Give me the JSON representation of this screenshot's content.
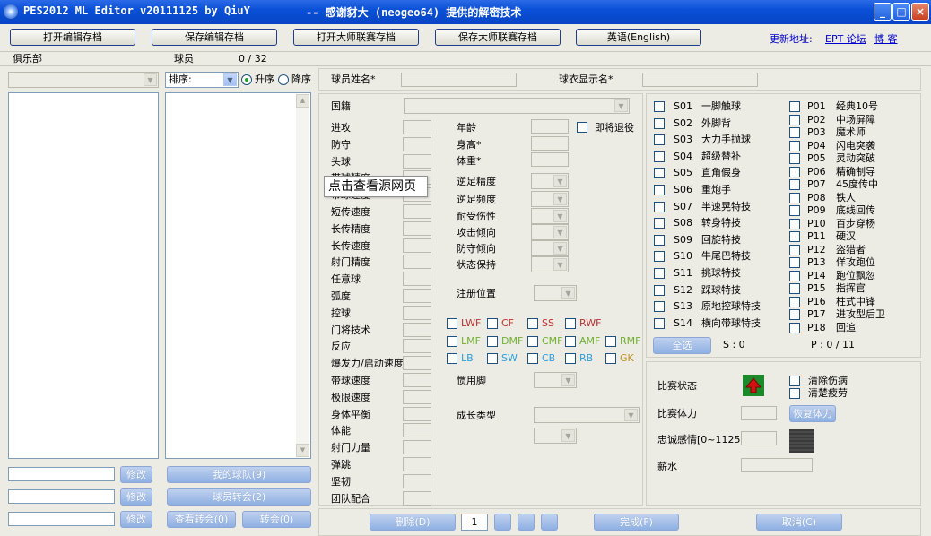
{
  "window": {
    "title": "PES2012 ML Editor v20111125 by QiuY",
    "subtitle": "-- 感谢豺大 (neogeo64) 提供的解密技术",
    "controls": [
      "_",
      "□",
      "×"
    ]
  },
  "toolbar": {
    "open_edit": "打开编辑存档",
    "save_edit": "保存编辑存档",
    "open_ml": "打开大师联赛存档",
    "save_ml": "保存大师联赛存档",
    "language": "英语(English)",
    "update_label": "更新地址:",
    "link_forum": "EPT 论坛",
    "link_blog": "博 客"
  },
  "header": {
    "club_label": "俱乐部",
    "players_label": "球员",
    "players_count": "0 / 32"
  },
  "sort": {
    "value": "排序:",
    "asc": "升序",
    "desc": "降序"
  },
  "left_bottom": {
    "btn_modify1": "修改",
    "btn_modify2": "修改",
    "btn_modify3": "修改",
    "btn_my_players": "我的球队(9)",
    "btn_players_cash": "球员转会(2)",
    "btn_view_transfer": "查看转会(0)",
    "btn_cancel_transfer": "转会(0)"
  },
  "player": {
    "name_label": "球员姓名*",
    "shirt_label": "球衣显示名*",
    "nationality_label": "国籍"
  },
  "attributes": [
    "进攻",
    "防守",
    "头球",
    "带球精度",
    "带球速度",
    "短传速度",
    "长传精度",
    "长传速度",
    "射门精度",
    "任意球",
    "弧度",
    "控球",
    "门将技术",
    "反应",
    "爆发力/启动速度",
    "带球速度",
    "极限速度",
    "身体平衡",
    "体能",
    "射门力量",
    "弹跳",
    "坚韧",
    "团队配合"
  ],
  "bio": {
    "age": "年龄",
    "retire": "即将退役",
    "height": "身高*",
    "weight": "体重*",
    "weak_foot_acc": "逆足精度",
    "weak_foot_freq": "逆足频度",
    "injury_tol": "耐受伤性",
    "attack_tend": "攻击倾向",
    "defend_tend": "防守倾向",
    "form": "状态保持",
    "reg_pos": "注册位置",
    "foot": "惯用脚",
    "growth": "成长类型"
  },
  "positions": {
    "row1": [
      "LWF",
      "CF",
      "SS",
      "RWF"
    ],
    "row2": [
      "LMF",
      "DMF",
      "CMF",
      "AMF",
      "RMF"
    ],
    "row3": [
      "LB",
      "SW",
      "CB",
      "RB",
      "GK"
    ]
  },
  "skills_s": [
    {
      "code": "S01",
      "name": "一脚触球"
    },
    {
      "code": "S02",
      "name": "外脚背"
    },
    {
      "code": "S03",
      "name": "大力手抛球"
    },
    {
      "code": "S04",
      "name": "超级替补"
    },
    {
      "code": "S05",
      "name": "直角假身"
    },
    {
      "code": "S06",
      "name": "重炮手"
    },
    {
      "code": "S07",
      "name": "半速晃特技"
    },
    {
      "code": "S08",
      "name": "转身特技"
    },
    {
      "code": "S09",
      "name": "回旋特技"
    },
    {
      "code": "S10",
      "name": "牛尾巴特技"
    },
    {
      "code": "S11",
      "name": "挑球特技"
    },
    {
      "code": "S12",
      "name": "踩球特技"
    },
    {
      "code": "S13",
      "name": "原地控球特技"
    },
    {
      "code": "S14",
      "name": "横向带球特技"
    }
  ],
  "skills_p": [
    {
      "code": "P01",
      "name": "经典10号"
    },
    {
      "code": "P02",
      "name": "中场屏障"
    },
    {
      "code": "P03",
      "name": "魔术师"
    },
    {
      "code": "P04",
      "name": "闪电突袭"
    },
    {
      "code": "P05",
      "name": "灵动突破"
    },
    {
      "code": "P06",
      "name": "精确制导"
    },
    {
      "code": "P07",
      "name": "45度传中"
    },
    {
      "code": "P08",
      "name": "铁人"
    },
    {
      "code": "P09",
      "name": "底线回传"
    },
    {
      "code": "P10",
      "name": "百步穿杨"
    },
    {
      "code": "P11",
      "name": "硬汉"
    },
    {
      "code": "P12",
      "name": "盗猎者"
    },
    {
      "code": "P13",
      "name": "佯攻跑位"
    },
    {
      "code": "P14",
      "name": "跑位飘忽"
    },
    {
      "code": "P15",
      "name": "指挥官"
    },
    {
      "code": "P16",
      "name": "柱式中锋"
    },
    {
      "code": "P17",
      "name": "进攻型后卫"
    },
    {
      "code": "P18",
      "name": "回追"
    }
  ],
  "skills_footer": {
    "clear_btn": "全选",
    "s_count": "S : 0",
    "p_count": "P : 0 / 11"
  },
  "status": {
    "match_state": "比赛状态",
    "clear_injury": "清除伤病",
    "clear_fatigue": "清楚疲劳",
    "match_stamina": "比赛体力",
    "stamina_btn": "恢复体力",
    "loyalty": "忠诚感情[0~1125]",
    "salary": "薪水"
  },
  "bottom": {
    "btn_delete": "删除(D)",
    "page": "1",
    "btn_complete": "完成(F)",
    "btn_cancel": "取消(C)"
  },
  "tooltip": "点击查看源网页",
  "colors": {
    "pos_attack": "#c03030",
    "pos_mid": "#70b030",
    "pos_def": "#2a9fe0",
    "pos_gk": "#c09020"
  }
}
